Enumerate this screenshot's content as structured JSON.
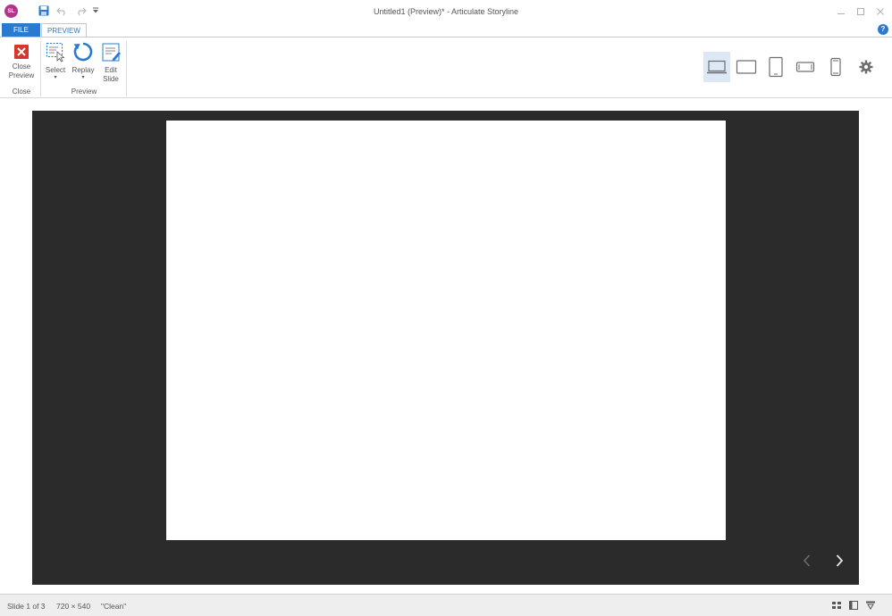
{
  "window": {
    "app_logo": "SL",
    "title": "Untitled1 (Preview)* -  Articulate Storyline"
  },
  "quick_access": {
    "icons": [
      "save-icon",
      "undo-icon",
      "redo-icon",
      "customize-dropdown-icon"
    ]
  },
  "tabs": [
    {
      "label": "FILE",
      "active": false
    },
    {
      "label": "PREVIEW",
      "active": true
    }
  ],
  "help_label": "?",
  "ribbon": {
    "close_group": {
      "button_label_line1": "Close",
      "button_label_line2": "Preview",
      "group_label": "Close"
    },
    "preview_group": {
      "select_label": "Select",
      "replay_label": "Replay",
      "edit_label_line1": "Edit",
      "edit_label_line2": "Slide",
      "group_label": "Preview"
    },
    "devices": [
      {
        "name": "desktop",
        "active": true
      },
      {
        "name": "tablet-landscape",
        "active": false
      },
      {
        "name": "tablet-portrait",
        "active": false
      },
      {
        "name": "phone-landscape",
        "active": false
      },
      {
        "name": "phone-portrait",
        "active": false
      }
    ]
  },
  "colors": {
    "accent": "#2a7bd0",
    "player_bg": "#2b2b2b",
    "close_red": "#d0392b",
    "logo_purple": "#b2358c"
  },
  "status": {
    "slide": "Slide 1 of 3",
    "size": "720 × 540",
    "theme": "\"Clean\""
  }
}
